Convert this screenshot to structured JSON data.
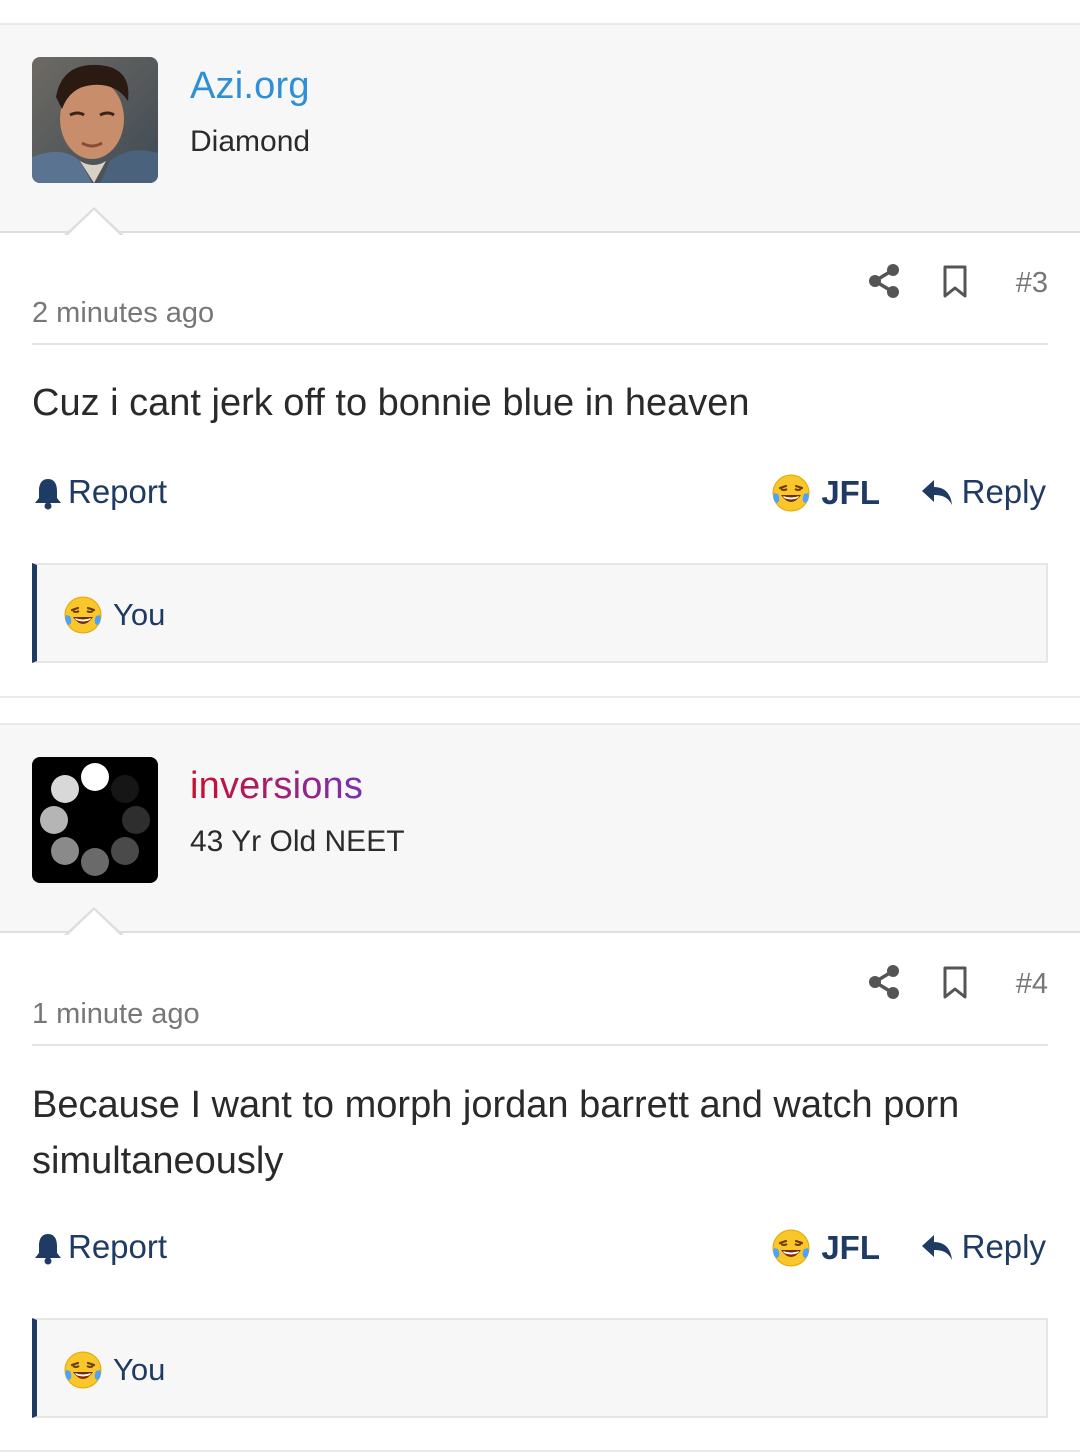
{
  "posts": [
    {
      "username": "Azi.org",
      "username_color": "#2e8fd6",
      "user_title": "Diamond",
      "timestamp": "2 minutes ago",
      "post_number": "#3",
      "body": "Cuz i cant jerk off to bonnie blue in heaven",
      "actions": {
        "report": "Report",
        "jfl": "JFL",
        "reply": "Reply"
      },
      "reaction": {
        "user": "You",
        "icon": "laughing-crying-emoji-icon"
      }
    },
    {
      "username": "inversions",
      "username_color": "gradient-red-purple",
      "user_title": "43 Yr Old NEET",
      "timestamp": "1 minute ago",
      "post_number": "#4",
      "body": "Because I want to morph jordan barrett and watch porn simultaneously",
      "actions": {
        "report": "Report",
        "jfl": "JFL",
        "reply": "Reply"
      },
      "reaction": {
        "user": "You",
        "icon": "laughing-crying-emoji-icon"
      }
    }
  ],
  "colors": {
    "accent": "#1f3a63",
    "header_bg": "#f7f7f7",
    "muted_text": "#777777"
  }
}
